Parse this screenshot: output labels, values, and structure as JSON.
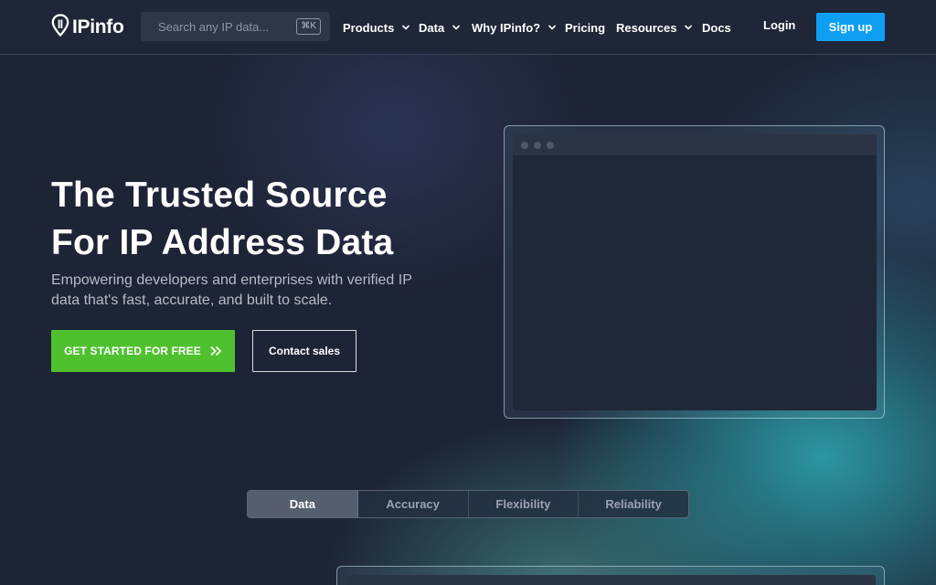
{
  "brand": {
    "name": "IPinfo",
    "icon": "location-pin-icon"
  },
  "search": {
    "placeholder": "Search any IP data...",
    "shortcut": "⌘K"
  },
  "nav": {
    "items": [
      {
        "label": "Products",
        "has_dropdown": true
      },
      {
        "label": "Data",
        "has_dropdown": true
      },
      {
        "label": "Why IPinfo?",
        "has_dropdown": true
      },
      {
        "label": "Pricing",
        "has_dropdown": false
      },
      {
        "label": "Resources",
        "has_dropdown": true
      },
      {
        "label": "Docs",
        "has_dropdown": false
      }
    ],
    "login": "Login",
    "signup": "Sign up"
  },
  "hero": {
    "title_line1": "The Trusted Source",
    "title_line2": "For IP Address Data",
    "subtitle": "Empowering developers and enterprises with verified IP data that's fast, accurate, and built to scale.",
    "cta_primary": "GET STARTED FOR FREE",
    "cta_secondary": "Contact sales"
  },
  "tabs": [
    {
      "label": "Data",
      "active": true
    },
    {
      "label": "Accuracy",
      "active": false
    },
    {
      "label": "Flexibility",
      "active": false
    },
    {
      "label": "Reliability",
      "active": false
    }
  ],
  "colors": {
    "background": "#1e2536",
    "accent_blue": "#0f9ff2",
    "accent_green": "#4fc12f"
  }
}
